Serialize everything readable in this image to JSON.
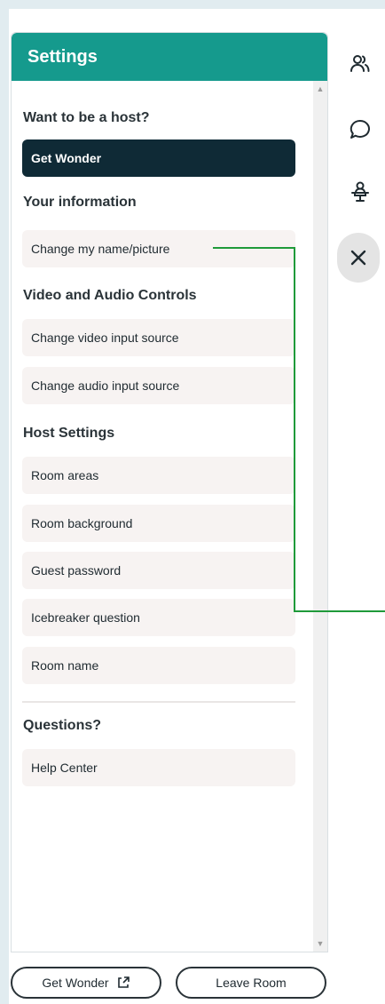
{
  "panel": {
    "title": "Settings",
    "sections": {
      "host": {
        "heading": "Want to be a host?",
        "button_label": "Get Wonder"
      },
      "info": {
        "heading": "Your information",
        "items": [
          "Change my name/picture"
        ]
      },
      "av": {
        "heading": "Video and Audio Controls",
        "items": [
          "Change video input source",
          "Change audio input source"
        ]
      },
      "host_settings": {
        "heading": "Host Settings",
        "items": [
          "Room areas",
          "Room background",
          "Guest password",
          "Icebreaker question",
          "Room name"
        ]
      },
      "questions": {
        "heading": "Questions?",
        "items": [
          "Help Center"
        ]
      }
    }
  },
  "right_toolbar": {
    "icons": [
      "people-icon",
      "chat-icon",
      "person-at-desk-icon",
      "close-icon"
    ]
  },
  "footer": {
    "get_wonder_label": "Get Wonder",
    "leave_room_label": "Leave Room"
  },
  "colors": {
    "header": "#159a8d",
    "primary_button": "#0f2a36",
    "annotation": "#1f9a3a"
  }
}
